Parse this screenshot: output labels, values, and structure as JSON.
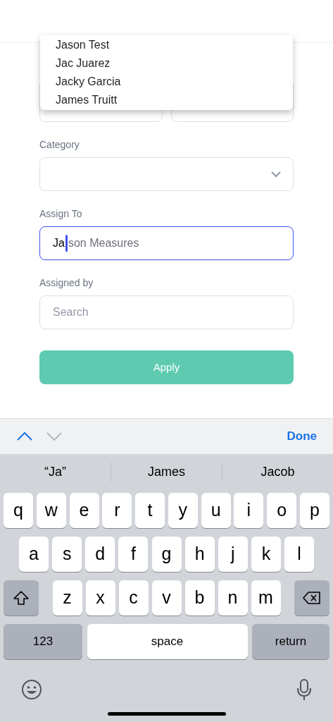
{
  "dropdown": {
    "options": [
      "Jason Test",
      "Jac Juarez",
      "Jacky Garcia",
      "James Truitt"
    ]
  },
  "form": {
    "fields": [
      {
        "kind": "select",
        "label": "Category"
      },
      {
        "kind": "autocomplete",
        "label": "Assign To",
        "value": "Ja",
        "suggestion": "son Measures",
        "focused": true
      },
      {
        "kind": "text",
        "label": "Assigned by",
        "placeholder": "Search",
        "focused": false
      }
    ],
    "submit": "Apply"
  },
  "keyboard_toolbar": {
    "done": "Done"
  },
  "suggestions": [
    "“Ja”",
    "James",
    "Jacob"
  ],
  "keyboard": {
    "key_rows": [
      {
        "keys": [
          {
            "kind": "char",
            "label": "q"
          },
          {
            "kind": "char",
            "label": "w"
          },
          {
            "kind": "char",
            "label": "e"
          },
          {
            "kind": "char",
            "label": "r"
          },
          {
            "kind": "char",
            "label": "t"
          },
          {
            "kind": "char",
            "label": "y"
          },
          {
            "kind": "char",
            "label": "u"
          },
          {
            "kind": "char",
            "label": "i"
          },
          {
            "kind": "char",
            "label": "o"
          },
          {
            "kind": "char",
            "label": "p"
          }
        ]
      },
      {
        "keys": [
          {
            "kind": "char",
            "label": "a"
          },
          {
            "kind": "char",
            "label": "s"
          },
          {
            "kind": "char",
            "label": "d"
          },
          {
            "kind": "char",
            "label": "f"
          },
          {
            "kind": "char",
            "label": "g"
          },
          {
            "kind": "char",
            "label": "h"
          },
          {
            "kind": "char",
            "label": "j"
          },
          {
            "kind": "char",
            "label": "k"
          },
          {
            "kind": "char",
            "label": "l"
          }
        ]
      },
      {
        "keys": [
          {
            "kind": "shift"
          },
          {
            "kind": "char",
            "label": "z"
          },
          {
            "kind": "char",
            "label": "x"
          },
          {
            "kind": "char",
            "label": "c"
          },
          {
            "kind": "char",
            "label": "v"
          },
          {
            "kind": "char",
            "label": "b"
          },
          {
            "kind": "char",
            "label": "n"
          },
          {
            "kind": "char",
            "label": "m"
          },
          {
            "kind": "delete"
          }
        ]
      },
      {
        "keys": [
          {
            "kind": "mode",
            "label": "123"
          },
          {
            "kind": "space",
            "label": "space"
          },
          {
            "kind": "return",
            "label": "return"
          }
        ]
      }
    ]
  }
}
